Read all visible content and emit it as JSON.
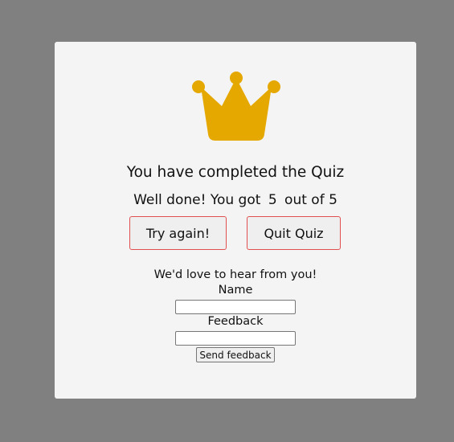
{
  "colors": {
    "overlay": "#808080",
    "card": "#f4f4f4",
    "crown": "#e5a800",
    "button_border": "#e05050"
  },
  "icon": "crown-icon",
  "result": {
    "title": "You have completed the Quiz",
    "prefix": "Well done! You got",
    "score": "5",
    "middle": "out of",
    "total": "5"
  },
  "buttons": {
    "try_again": "Try again!",
    "quit": "Quit Quiz"
  },
  "feedback": {
    "heading": "We'd love to hear from you!",
    "name_label": "Name",
    "name_value": "",
    "feedback_label": "Feedback",
    "feedback_value": "",
    "send_label": "Send feedback"
  }
}
